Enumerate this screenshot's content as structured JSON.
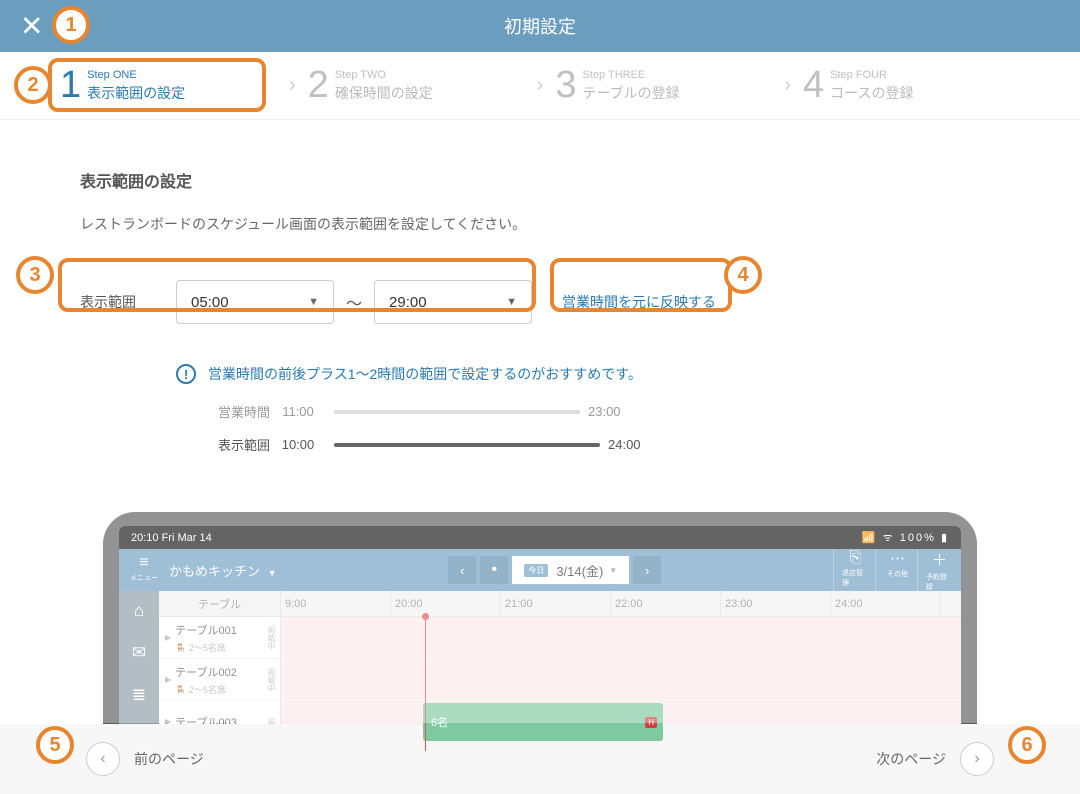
{
  "header": {
    "title": "初期設定"
  },
  "steps": [
    {
      "num": "1",
      "label": "Step ONE",
      "title": "表示範囲の設定",
      "active": true
    },
    {
      "num": "2",
      "label": "Step TWO",
      "title": "確保時間の設定",
      "active": false
    },
    {
      "num": "3",
      "label": "Step THREE",
      "title": "テーブルの登録",
      "active": false
    },
    {
      "num": "4",
      "label": "Step FOUR",
      "title": "コースの登録",
      "active": false
    }
  ],
  "section": {
    "title": "表示範囲の設定",
    "desc": "レストランボードのスケジュール画面の表示範囲を設定してください。",
    "range_label": "表示範囲",
    "from": "05:00",
    "tilde": "〜",
    "to": "29:00",
    "reflect": "営業時間を元に反映する",
    "hint": "営業時間の前後プラス1〜2時間の範囲で設定するのがおすすめです。",
    "example": {
      "biz_label": "営業時間",
      "biz_from": "11:00",
      "biz_to": "23:00",
      "disp_label": "表示範囲",
      "disp_from": "10:00",
      "disp_to": "24:00"
    }
  },
  "tablet": {
    "status_time": "20:10  Fri Mar 14",
    "status_right": "100%",
    "menu_label": "メニュー",
    "app_title": "かもめキッチン",
    "today": "今日",
    "date": "3/14(金)",
    "actions": {
      "a1": "退店管理",
      "a2": "その他",
      "a3": "予約登録"
    },
    "table_head": "テーブル",
    "time_cols": [
      "9:00",
      "20:00",
      "21:00",
      "22:00",
      "23:00",
      "24:00"
    ],
    "rows": [
      {
        "name": "テーブル001",
        "seats": "2〜5名席",
        "badge": "掲載中"
      },
      {
        "name": "テーブル002",
        "seats": "2〜5名席",
        "badge": "掲載中"
      },
      {
        "name": "テーブル003",
        "seats": "",
        "badge": "掲"
      }
    ],
    "booking": {
      "label": "6名",
      "icon": "H"
    }
  },
  "footer": {
    "prev": "前のページ",
    "next": "次のページ"
  },
  "callouts": [
    "1",
    "2",
    "3",
    "4",
    "5",
    "6"
  ]
}
